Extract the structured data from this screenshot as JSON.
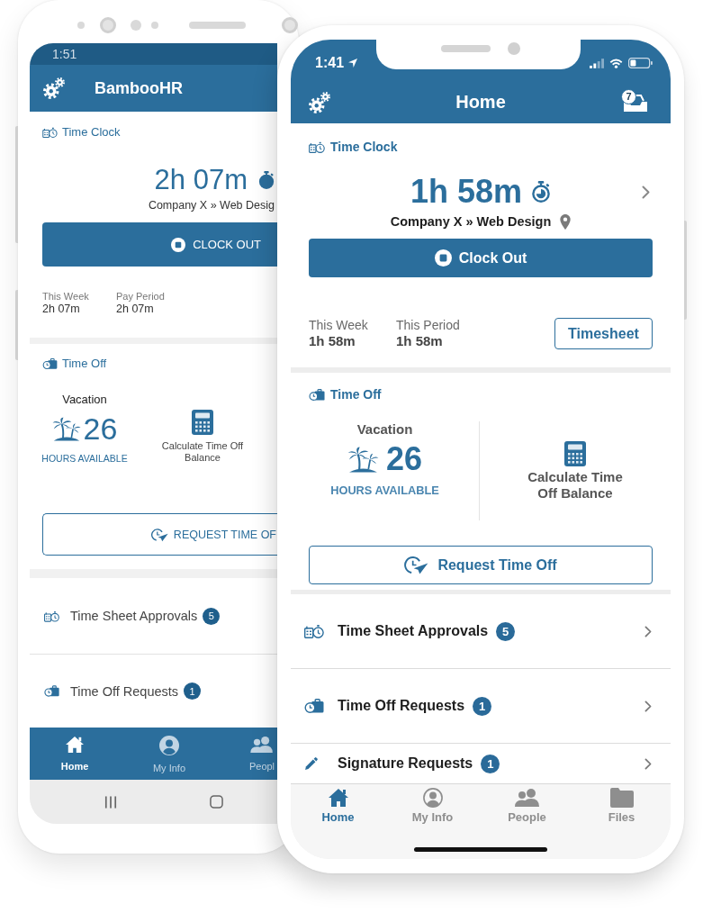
{
  "android_phone": {
    "status_bar": {
      "time": "1:51"
    },
    "app_bar": {
      "title": "BambooHR"
    },
    "time_clock": {
      "title": "Time Clock",
      "duration": "2h 07m",
      "project": "Company X » Web Desig",
      "clock_out_label": "CLOCK OUT",
      "totals": [
        {
          "label": "This Week",
          "value": "2h 07m"
        },
        {
          "label": "Pay Period",
          "value": "2h 07m"
        }
      ]
    },
    "time_off": {
      "title": "Time Off",
      "policy": "Vacation",
      "hours": "26",
      "hours_caption": "HOURS AVAILABLE",
      "calculate_label": "Calculate Time Off Balance",
      "request_label": "REQUEST TIME OF"
    },
    "list": [
      {
        "kind": "timesheet",
        "label": "Time Sheet Approvals",
        "count": "5"
      },
      {
        "kind": "time_off",
        "label": "Time Off Requests",
        "count": "1"
      }
    ],
    "tab_bar": [
      {
        "kind": "home",
        "label": "Home",
        "selected": true
      },
      {
        "kind": "person",
        "label": "My Info",
        "selected": false
      },
      {
        "kind": "people",
        "label": "Peopl",
        "selected": false
      }
    ]
  },
  "iphone": {
    "status_bar": {
      "time": "1:41"
    },
    "app_bar": {
      "title": "Home",
      "inbox_count": "7"
    },
    "time_clock": {
      "title": "Time Clock",
      "duration": "1h 58m",
      "project": "Company X » Web Design",
      "clock_out_label": "Clock Out",
      "totals": [
        {
          "label": "This Week",
          "value": "1h 58m"
        },
        {
          "label": "This Period",
          "value": "1h 58m"
        }
      ],
      "timesheet_button": "Timesheet"
    },
    "time_off": {
      "title": "Time Off",
      "policy": "Vacation",
      "hours": "26",
      "hours_caption": "HOURS AVAILABLE",
      "calculate_label": "Calculate Time Off Balance",
      "request_label": "Request Time Off"
    },
    "list": [
      {
        "kind": "timesheet",
        "label": "Time Sheet Approvals",
        "count": "5"
      },
      {
        "kind": "time_off",
        "label": "Time Off Requests",
        "count": "1"
      },
      {
        "kind": "signature",
        "label": "Signature Requests",
        "count": "1"
      }
    ],
    "tab_bar": [
      {
        "kind": "home",
        "label": "Home",
        "selected": true
      },
      {
        "kind": "person",
        "label": "My Info",
        "selected": false
      },
      {
        "kind": "people",
        "label": "People",
        "selected": false
      },
      {
        "kind": "files",
        "label": "Files",
        "selected": false
      }
    ]
  }
}
